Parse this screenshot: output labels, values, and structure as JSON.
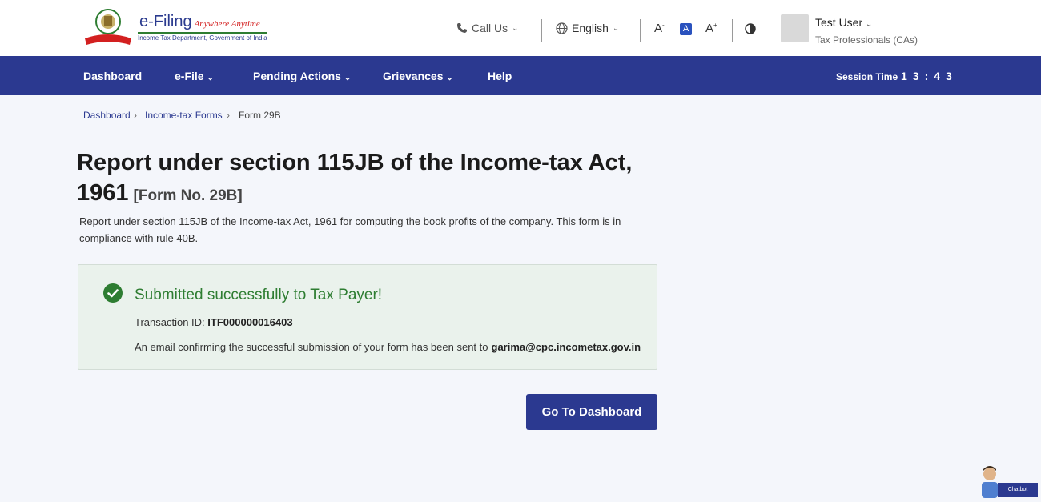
{
  "header": {
    "logo_title": "e-Filing",
    "logo_tagline": "Anywhere Anytime",
    "logo_subtitle": "Income Tax Department, Government of India",
    "call_us": "Call Us",
    "language": "English",
    "font_decrease": "A",
    "font_default": "A",
    "font_increase": "A",
    "user_name": "Test User",
    "user_role": "Tax Professionals (CAs)"
  },
  "nav": {
    "items": [
      "Dashboard",
      "e-File",
      "Pending Actions",
      "Grievances",
      "Help"
    ],
    "session_label": "Session Time",
    "session_time": "13:43"
  },
  "breadcrumb": [
    "Dashboard",
    "Income-tax Forms",
    "Form 29B"
  ],
  "page": {
    "title": "Report under section 115JB of the Income-tax Act, 1961",
    "form_no": "[Form No. 29B]",
    "description": "Report under section 115JB of the Income-tax Act, 1961 for computing the book profits of the company. This form is in compliance with rule 40B."
  },
  "success": {
    "title": "Submitted successfully to Tax Payer!",
    "txn_label": "Transaction ID:",
    "txn_id": "ITF000000016403",
    "email_text": "An email confirming the successful submission of your form has been sent to",
    "email": "garima@cpc.incometax.gov.in"
  },
  "actions": {
    "dashboard_button": "Go To Dashboard"
  },
  "chatbot": {
    "label": "Chatbot"
  },
  "colors": {
    "primary": "#2b3990",
    "success": "#2e7d32",
    "success_bg": "#eaf2ec"
  }
}
